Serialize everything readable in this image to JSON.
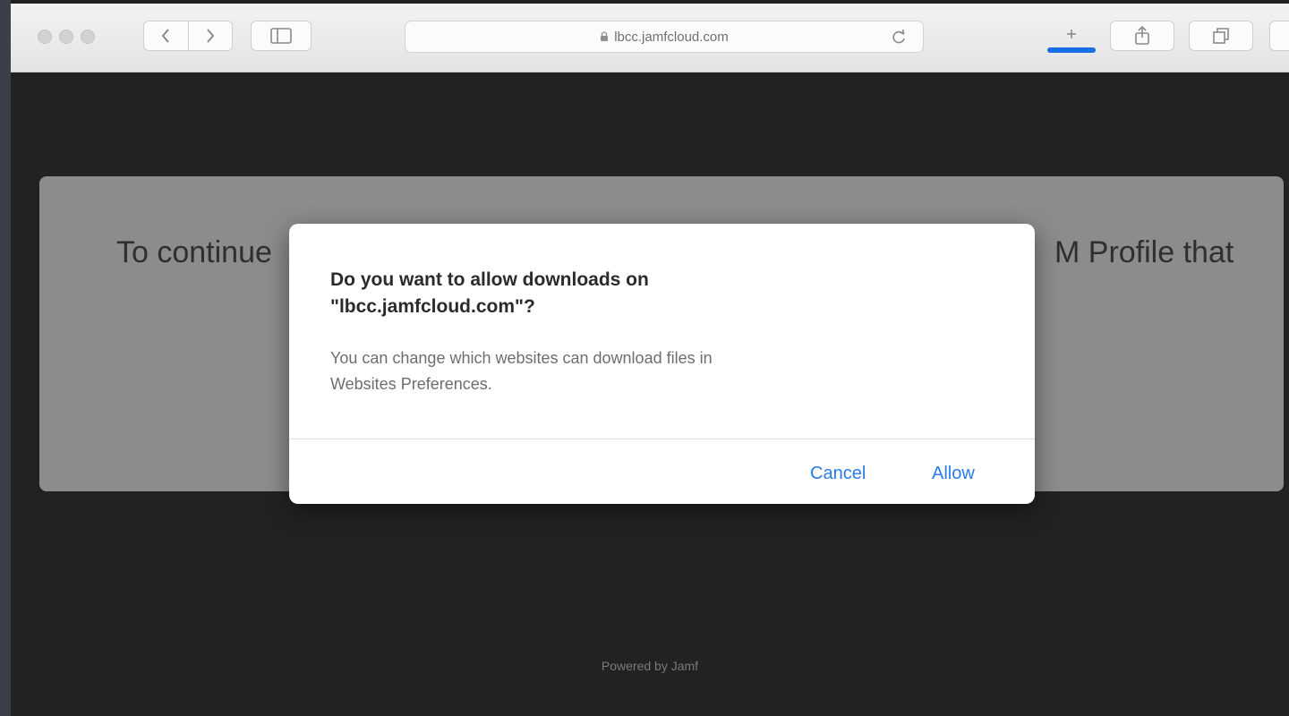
{
  "browser": {
    "url": "lbcc.jamfcloud.com",
    "icons": [
      "lock-icon",
      "reload-icon",
      "back-icon",
      "forward-icon",
      "sidebar-icon",
      "download-icon",
      "share-icon",
      "tabs-icon"
    ],
    "download_progress_color": "#1a6fe6"
  },
  "page": {
    "text_left": "To continue",
    "text_right": "M Profile that",
    "footer": "Powered by Jamf"
  },
  "dialog": {
    "title_line1": "Do you want to allow downloads on",
    "title_line2": "\"lbcc.jamfcloud.com\"?",
    "body_line1": "You can change which websites can download files in",
    "body_line2": "Websites Preferences.",
    "cancel_label": "Cancel",
    "allow_label": "Allow",
    "button_color": "#2a7be6"
  }
}
